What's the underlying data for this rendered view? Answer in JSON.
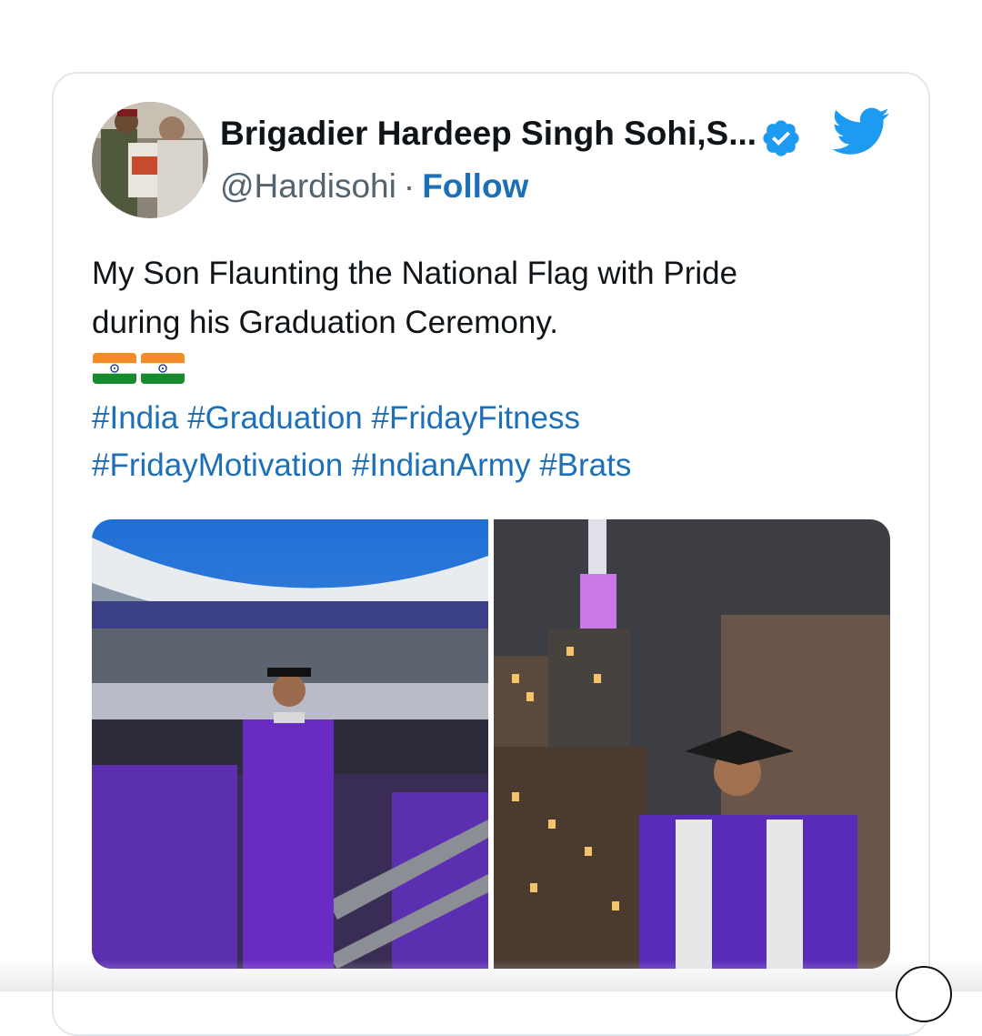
{
  "author": {
    "display_name": "Brigadier Hardeep Singh Sohi,S...",
    "handle": "@Hardisohi",
    "separator": "·",
    "follow_label": "Follow"
  },
  "tweet": {
    "text_line1": "My Son Flaunting the National Flag with Pride",
    "text_line2": "during his Graduation Ceremony.",
    "hashtags_line1": [
      "#India",
      "#Graduation",
      "#FridayFitness"
    ],
    "hashtags_line2": [
      "#FridayMotivation",
      "#IndianArmy",
      "#Brats"
    ]
  },
  "colors": {
    "link": "#1d70b8",
    "verified": "#1d9bf0",
    "twitter_blue": "#1d9bf0",
    "gown_purple": "#6a2bc4"
  },
  "icons": {
    "verified": "verified-badge-icon",
    "brand": "twitter-bird-icon"
  },
  "media": {
    "count": 2,
    "images": [
      "stadium-graduation-photo",
      "empire-state-building-photo"
    ]
  }
}
